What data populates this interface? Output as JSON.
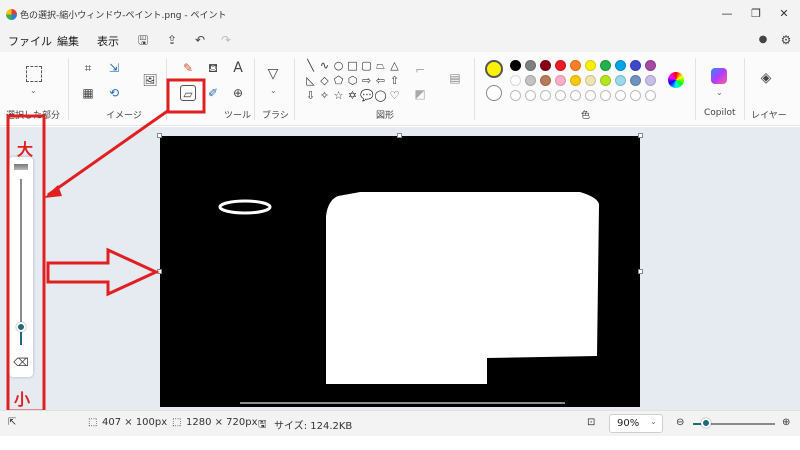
{
  "window": {
    "title": "色の選択-縮小ウィンドウ-ペイント.png - ペイント"
  },
  "menu": {
    "items": [
      "ファイル",
      "編集",
      "表示"
    ]
  },
  "ribbon": {
    "groups": {
      "selection": "選択した部分",
      "image": "イメージ",
      "tools": "ツール",
      "brush": "ブラシ",
      "shapes": "図形",
      "colors": "色",
      "copilot": "Copilot",
      "layers": "レイヤー"
    },
    "palette_row1": [
      "#000000",
      "#7f7f7f",
      "#880015",
      "#ed1c24",
      "#ff7f27",
      "#fff200",
      "#22b14c",
      "#00a2e8",
      "#3f48cc",
      "#a349a4"
    ],
    "palette_row2": [
      "#ffffff",
      "#c3c3c3",
      "#b97a57",
      "#ffaec9",
      "#ffc90e",
      "#efe4b0",
      "#b5e61d",
      "#99d9ea",
      "#7092be",
      "#c8bfe7"
    ],
    "primary_color": "#fff200",
    "secondary_color": "#ffffff"
  },
  "annotation": {
    "large": "大",
    "small": "小",
    "accent": "#e02020"
  },
  "status": {
    "selection_size": "407 × 100px",
    "image_size": "1280 × 720px",
    "file_size": "サイズ: 124.2KB",
    "zoom": "90%"
  }
}
